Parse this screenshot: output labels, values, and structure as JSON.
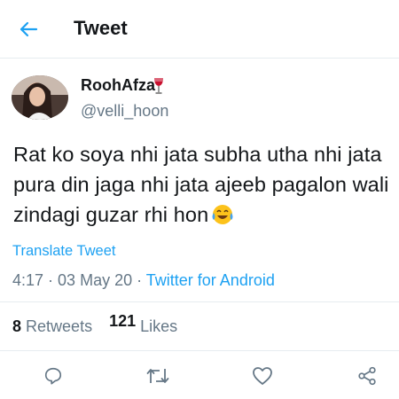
{
  "header": {
    "title": "Tweet"
  },
  "tweet": {
    "display_name": "RoohAfza",
    "username": "@velli_hoon",
    "text": "Rat ko soya nhi jata subha utha nhi jata pura din jaga nhi jata ajeeb pagalon wali zindagi guzar rhi hon",
    "translate_label": "Translate Tweet",
    "time": "4:17",
    "date": "03 May 20",
    "separator": " · ",
    "source": "Twitter for Android"
  },
  "stats": {
    "retweets_count": "8",
    "retweets_label": "Retweets",
    "likes_count": "121",
    "likes_label": "Likes"
  },
  "icons": {
    "back": "arrow-left-icon",
    "drink": "wine-glass-icon",
    "emoji": "tears-of-joy-emoji-icon",
    "reply": "reply-icon",
    "retweet": "retweet-icon",
    "like": "heart-icon",
    "share": "share-icon"
  },
  "colors": {
    "accent": "#1da1f2",
    "secondary_text": "#657786",
    "primary_text": "#14171a"
  }
}
